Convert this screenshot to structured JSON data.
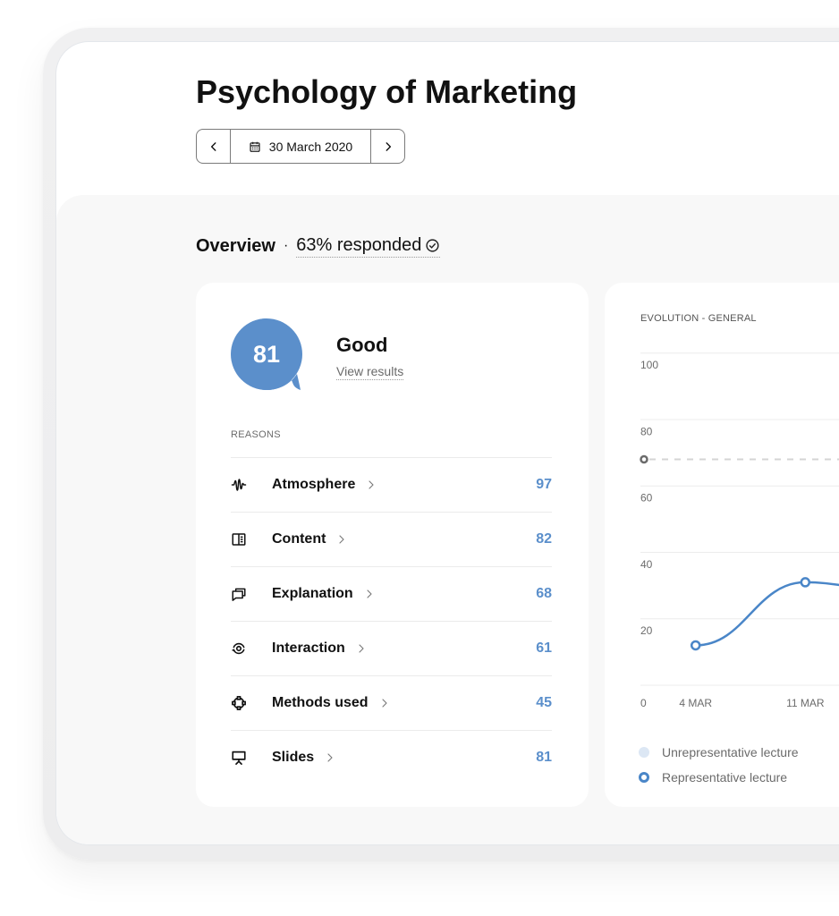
{
  "page": {
    "title": "Psychology of Marketing"
  },
  "date_nav": {
    "prev_icon": "chevron-left-icon",
    "calendar_icon": "calendar-icon",
    "date": "30 March 2020",
    "next_icon": "chevron-right-icon"
  },
  "overview": {
    "label": "Overview",
    "separator": "·",
    "responded": "63% responded",
    "responded_icon": "check-circle-icon"
  },
  "score_card": {
    "score": "81",
    "rating": "Good",
    "view_results": "View results",
    "reasons_heading": "REASONS",
    "reasons": [
      {
        "icon": "waveform-icon",
        "label": "Atmosphere",
        "value": "97"
      },
      {
        "icon": "book-icon",
        "label": "Content",
        "value": "82"
      },
      {
        "icon": "chat-bubbles-icon",
        "label": "Explanation",
        "value": "68"
      },
      {
        "icon": "rotate-view-icon",
        "label": "Interaction",
        "value": "61"
      },
      {
        "icon": "shape-nodes-icon",
        "label": "Methods used",
        "value": "45"
      },
      {
        "icon": "presentation-icon",
        "label": "Slides",
        "value": "81"
      }
    ]
  },
  "colors": {
    "accent": "#5B8FCB",
    "line": "#4A86C8",
    "unrepresentative": "#DCE7F4",
    "reference": "#C8C8C8",
    "gray_bg": "#F8F8F8",
    "text": "#111111"
  },
  "chart_data": {
    "type": "line",
    "title": "EVOLUTION - GENERAL",
    "xlabel": "",
    "ylabel": "",
    "categories": [
      "4 MAR",
      "11 MAR"
    ],
    "series": [
      {
        "name": "Representative lecture",
        "values": [
          12,
          31
        ],
        "color": "#4A86C8"
      }
    ],
    "reference_line": {
      "value": 68,
      "style": "dashed",
      "color": "#C8C8C8"
    },
    "yticks": [
      0,
      20,
      40,
      60,
      80,
      100
    ],
    "ylim": [
      0,
      100
    ],
    "grid": true,
    "legend_position": "bottom-left",
    "legend": [
      {
        "label": "Unrepresentative lecture",
        "color": "#DCE7F4"
      },
      {
        "label": "Representative lecture",
        "color": "#4A86C8"
      }
    ]
  }
}
